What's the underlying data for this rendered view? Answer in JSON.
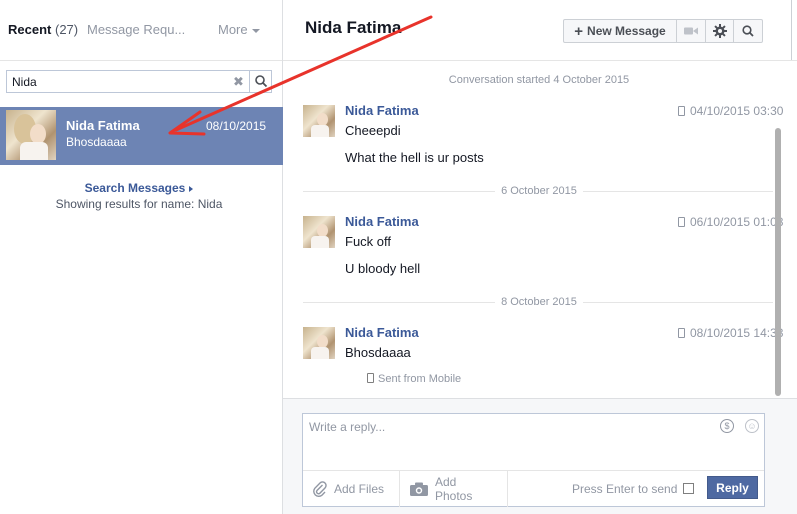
{
  "left_panel": {
    "tabs": {
      "recent_label": "Recent",
      "recent_count": "(27)",
      "requests_label": "Message Requ...",
      "more_label": "More"
    },
    "search": {
      "value": "Nida",
      "clear_glyph": "✖"
    },
    "thread": {
      "name": "Nida Fatima",
      "snippet": "Bhosdaaaa",
      "date": "08/10/2015"
    },
    "search_messages_label": "Search Messages",
    "search_results_text": "Showing results for name: Nida"
  },
  "conversation": {
    "title": "Nida Fatima",
    "toolbar": {
      "new_message_label": "New Message",
      "new_message_plus": "+",
      "video_icon": "video-camera-icon",
      "gear_icon": "gear-icon",
      "search_icon": "search-icon"
    },
    "started_text": "Conversation started 4 October 2015",
    "messages": [
      {
        "sender": "Nida Fatima",
        "time": "04/10/2015 03:30",
        "lines": [
          "Cheeepdi",
          "What the hell is ur posts"
        ]
      },
      {
        "divider": "6 October 2015",
        "sender": "Nida Fatima",
        "time": "06/10/2015 01:08",
        "lines": [
          "Fuck off",
          "U bloody hell"
        ]
      },
      {
        "divider": "8 October 2015",
        "sender": "Nida Fatima",
        "time": "08/10/2015 14:33",
        "lines": [
          "Bhosdaaaa"
        ],
        "sent_from": "Sent from Mobile"
      }
    ]
  },
  "composer": {
    "placeholder": "Write a reply...",
    "dollar_glyph": "$",
    "smile_glyph": "☺",
    "add_files_label": "Add Files",
    "add_photos_label": "Add Photos",
    "press_enter_label": "Press Enter to send",
    "press_enter_checked": false,
    "reply_label": "Reply"
  },
  "colors": {
    "selected_thread_bg": "#6d84b4",
    "link_blue": "#3b5998",
    "reply_button": "#4e69a2",
    "annotation_arrow": "#e8332b"
  }
}
